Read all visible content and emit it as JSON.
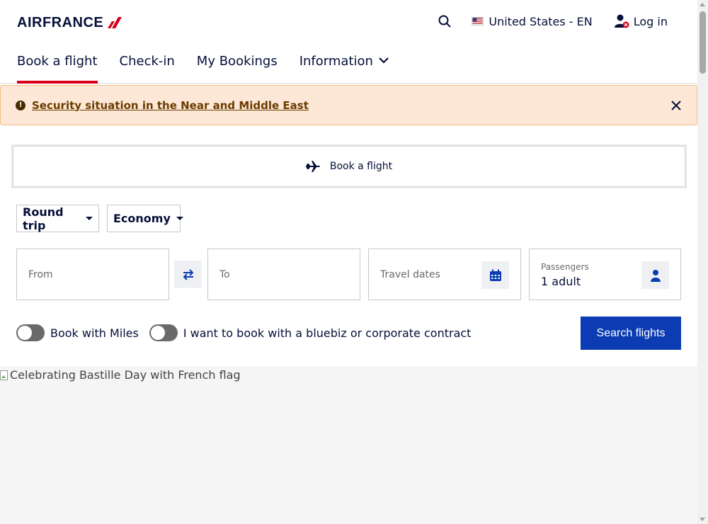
{
  "header": {
    "logo_text": "AIRFRANCE",
    "search_icon": "search-icon",
    "locale": "United States - EN",
    "flag_icon": "us-flag-icon",
    "login": "Log in",
    "login_icon": "user-icon"
  },
  "nav": {
    "items": [
      {
        "label": "Book a flight",
        "active": true
      },
      {
        "label": "Check-in",
        "active": false
      },
      {
        "label": "My Bookings",
        "active": false
      },
      {
        "label": "Information",
        "active": false
      }
    ]
  },
  "alert": {
    "text": "Security situation in the Near and Middle East",
    "icon": "alert-icon",
    "close_icon": "close-icon"
  },
  "booking": {
    "tab_label": "Book a flight",
    "tab_icon": "airplane-icon",
    "trip_type": "Round trip",
    "cabin": "Economy",
    "from_placeholder": "From",
    "to_placeholder": "To",
    "dates_placeholder": "Travel dates",
    "passengers_label": "Passengers",
    "passengers_value": "1 adult",
    "book_with_miles": "Book with Miles",
    "corporate": "I want to book with a bluebiz or corporate contract",
    "search_button": "Search flights"
  },
  "hero": {
    "alt": "Celebrating Bastille Day with French flag"
  },
  "colors": {
    "brand_navy": "#051039",
    "brand_red": "#d8001b",
    "button_blue": "#0b3cb3",
    "alert_bg": "#fde8d7"
  }
}
